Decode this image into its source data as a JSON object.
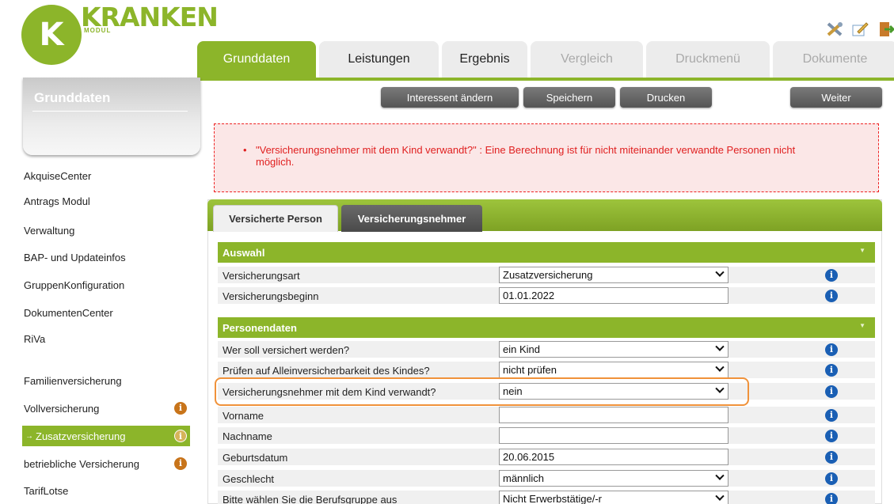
{
  "logo": {
    "letter": "K",
    "word": "KRANKEN",
    "sub": "MODUL"
  },
  "top_icons": [
    "tools-icon",
    "edit-note-icon",
    "exit-door-icon"
  ],
  "tabs": [
    {
      "label": "Grunddaten",
      "state": "active"
    },
    {
      "label": "Leistungen",
      "state": "normal"
    },
    {
      "label": "Ergebnis",
      "state": "normal"
    },
    {
      "label": "Vergleich",
      "state": "disabled"
    },
    {
      "label": "Druckmenü",
      "state": "disabled"
    },
    {
      "label": "Dokumente",
      "state": "disabled"
    }
  ],
  "sidebar": {
    "title": "Grunddaten",
    "items": [
      {
        "label": "AkquiseCenter"
      },
      {
        "label": "Antrags Modul"
      },
      {
        "label": "Verwaltung"
      },
      {
        "label": "BAP- und Updateinfos"
      },
      {
        "label": "GruppenKonfiguration"
      },
      {
        "label": "DokumentenCenter"
      },
      {
        "label": "RiVa"
      },
      {
        "label": "Familienversicherung"
      },
      {
        "label": "Vollversicherung",
        "info": true
      },
      {
        "label": "Zusatzversicherung",
        "info": true,
        "active": true
      },
      {
        "label": "betriebliche Versicherung",
        "info": true
      },
      {
        "label": "TarifLotse"
      }
    ]
  },
  "actions": {
    "interessent": "Interessent ändern",
    "speichern": "Speichern",
    "drucken": "Drucken",
    "weiter": "Weiter"
  },
  "error": {
    "line1": "\"Versicherungsnehmer mit dem Kind verwandt?\" : Eine Berechnung ist für nicht miteinander verwandte Personen nicht",
    "line2": "möglich."
  },
  "subtabs": {
    "active": "Versicherte Person",
    "inactive": "Versicherungsnehmer"
  },
  "sections": {
    "auswahl": {
      "title": "Auswahl",
      "rows": [
        {
          "label": "Versicherungsart",
          "value": "Zusatzversicherung",
          "type": "select"
        },
        {
          "label": "Versicherungsbeginn",
          "value": "01.01.2022",
          "type": "input"
        }
      ]
    },
    "personendaten": {
      "title": "Personendaten",
      "rows": [
        {
          "label": "Wer soll versichert werden?",
          "value": "ein Kind",
          "type": "select"
        },
        {
          "label": "Prüfen auf Alleinversicherbarkeit des Kindes?",
          "value": "nicht prüfen",
          "type": "select"
        },
        {
          "label": "Versicherungsnehmer mit dem Kind verwandt?",
          "value": "nein",
          "type": "select"
        },
        {
          "label": "Vorname",
          "value": "",
          "type": "input"
        },
        {
          "label": "Nachname",
          "value": "",
          "type": "input"
        },
        {
          "label": "Geburtsdatum",
          "value": "20.06.2015",
          "type": "input"
        },
        {
          "label": "Geschlecht",
          "value": "männlich",
          "type": "select"
        },
        {
          "label": "Bitte wählen Sie die Berufsgruppe aus",
          "value": "Nicht Erwerbstätige/-r",
          "type": "select"
        }
      ]
    }
  },
  "info_glyph": "i",
  "colors": {
    "brand_green": "#8cb52a",
    "error_red": "#e02020",
    "highlight_orange": "#f0923a",
    "info_blue": "#1a5fb4"
  }
}
